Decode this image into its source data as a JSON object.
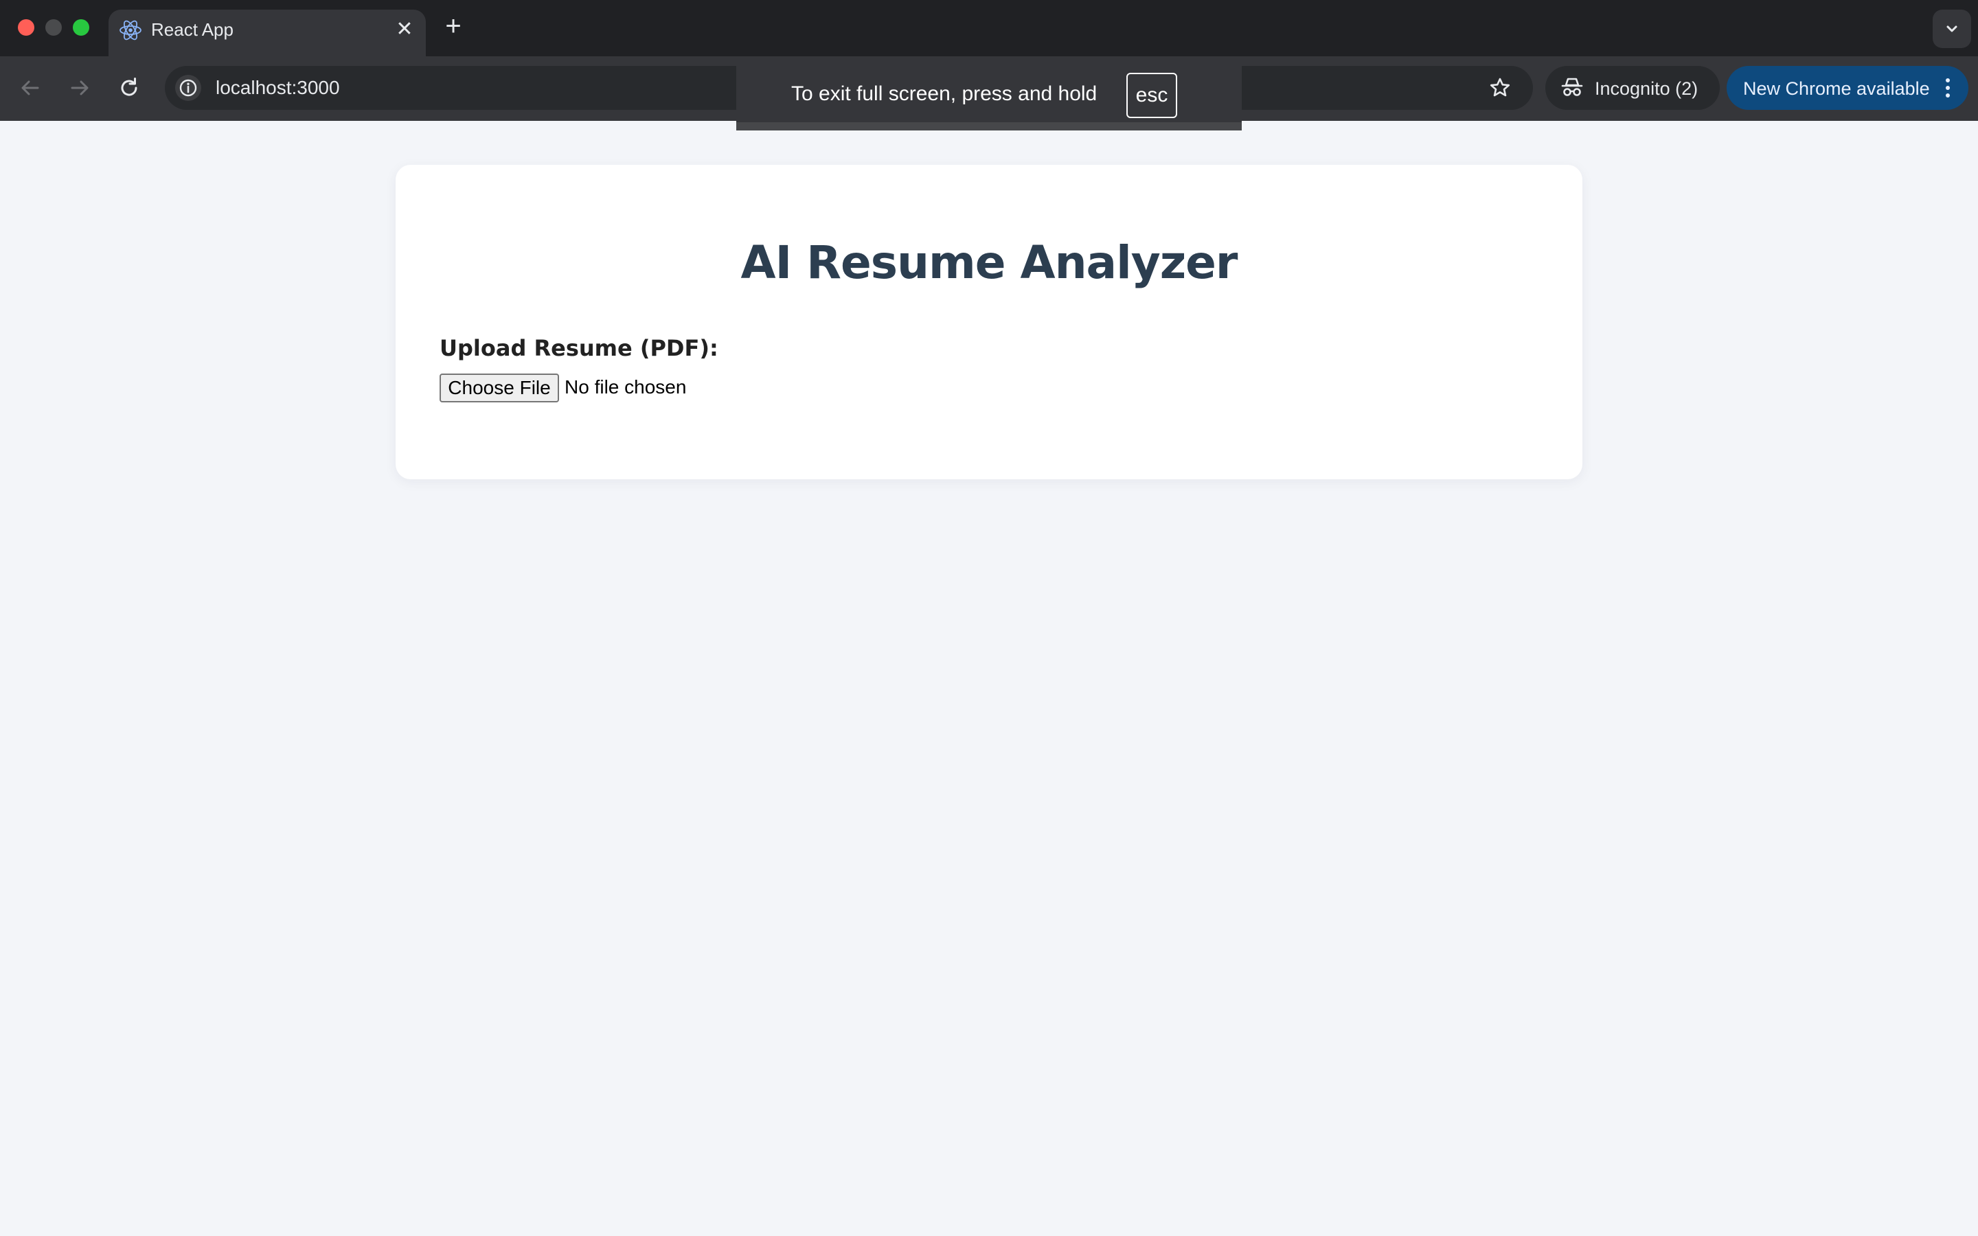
{
  "browser": {
    "tab": {
      "title": "React App",
      "icon": "react-logo-icon"
    },
    "url": "localhost:3000",
    "incognito_label": "Incognito (2)",
    "update_label": "New Chrome available"
  },
  "fullscreen_toast": {
    "message": "To exit full screen, press and hold",
    "key": "esc"
  },
  "page": {
    "title": "AI Resume Analyzer",
    "upload_label": "Upload Resume (PDF):",
    "choose_button": "Choose File",
    "file_status": "No file chosen"
  },
  "colors": {
    "page_background": "#f3f5f9",
    "card_background": "#ffffff",
    "title_color": "#2c3e50",
    "update_button": "#0e4a7e"
  }
}
